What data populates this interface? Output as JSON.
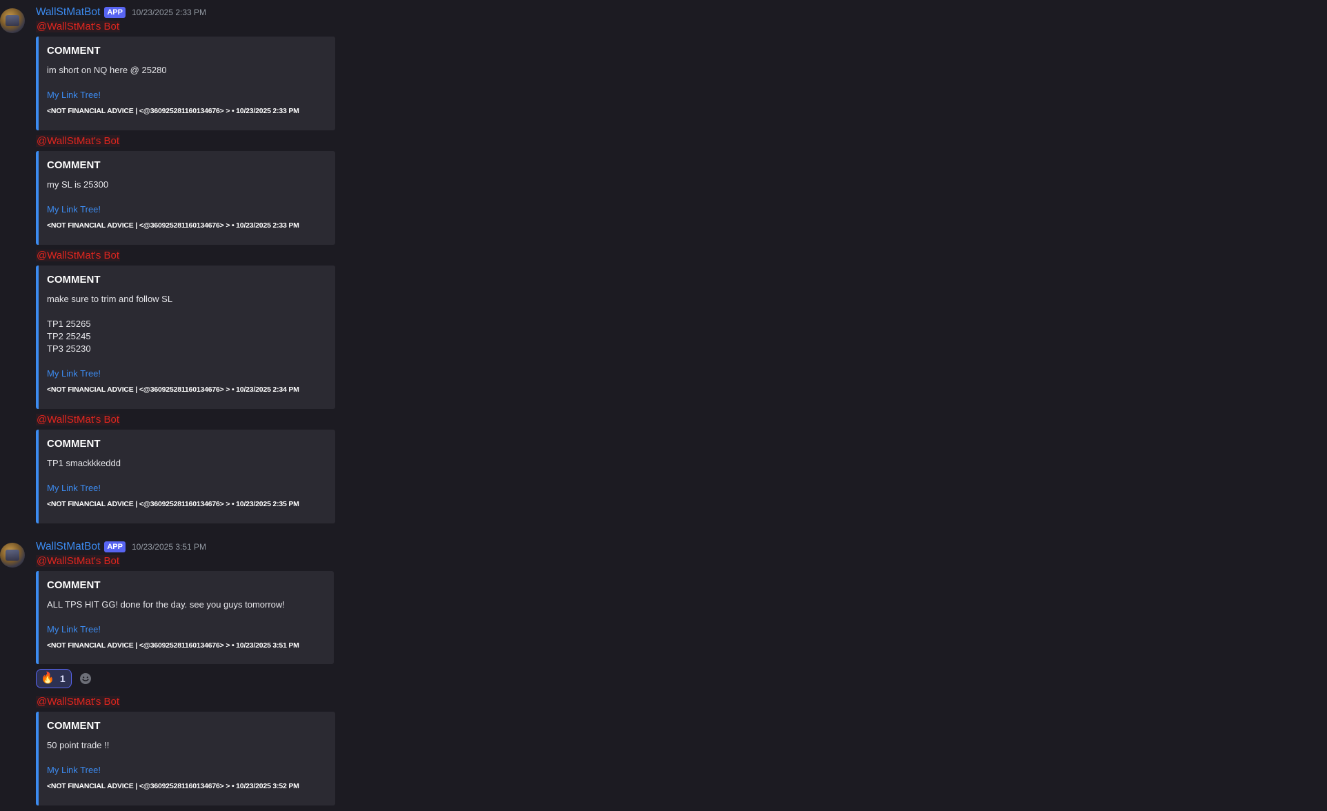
{
  "messages": [
    {
      "author": "WallStMatBot",
      "badge": "APP",
      "timestamp": "10/23/2025 2:33 PM",
      "avatar_icon": "bot-avatar",
      "posts": [
        {
          "mention": "@WallStMat's Bot",
          "title": "COMMENT",
          "description": "im short on NQ here @ 25280",
          "link": "My Link Tree!",
          "footer": "<NOT FINANCIAL ADVICE | <@360925281160134676> > • 10/23/2025 2:33 PM"
        },
        {
          "mention": "@WallStMat's Bot",
          "title": "COMMENT",
          "description": "my SL is 25300",
          "link": "My Link Tree!",
          "footer": "<NOT FINANCIAL ADVICE | <@360925281160134676> > • 10/23/2025 2:33 PM"
        },
        {
          "mention": "@WallStMat's Bot",
          "title": "COMMENT",
          "description": "make sure to trim and follow SL\n\nTP1 25265\nTP2 25245\nTP3 25230",
          "link": "My Link Tree!",
          "footer": "<NOT FINANCIAL ADVICE | <@360925281160134676> > • 10/23/2025 2:34 PM"
        },
        {
          "mention": "@WallStMat's Bot",
          "title": "COMMENT",
          "description": "TP1 smackkkeddd",
          "link": "My Link Tree!",
          "footer": "<NOT FINANCIAL ADVICE | <@360925281160134676> > • 10/23/2025 2:35 PM"
        }
      ]
    },
    {
      "author": "WallStMatBot",
      "badge": "APP",
      "timestamp": "10/23/2025 3:51 PM",
      "avatar_icon": "bot-avatar",
      "posts": [
        {
          "mention": "@WallStMat's Bot",
          "title": "COMMENT",
          "description": "ALL TPS HIT GG! done for the day. see you guys tomorrow!",
          "link": "My Link Tree!",
          "footer": "<NOT FINANCIAL ADVICE | <@360925281160134676> > • 10/23/2025 3:51 PM",
          "reactions": [
            {
              "emoji": "🔥",
              "icon": "fire-emoji",
              "count": "1"
            }
          ]
        },
        {
          "mention": "@WallStMat's Bot",
          "title": "COMMENT",
          "description": "50 point trade !!",
          "link": "My Link Tree!",
          "footer": "<NOT FINANCIAL ADVICE | <@360925281160134676> > • 10/23/2025 3:52 PM"
        }
      ]
    }
  ],
  "colors": {
    "background": "#1c1b22",
    "embed_background": "#2b2a32",
    "embed_accent": "#3c8bf0",
    "username": "#3c8bf0",
    "mention": "#e0261f",
    "app_badge": "#5865f2"
  }
}
